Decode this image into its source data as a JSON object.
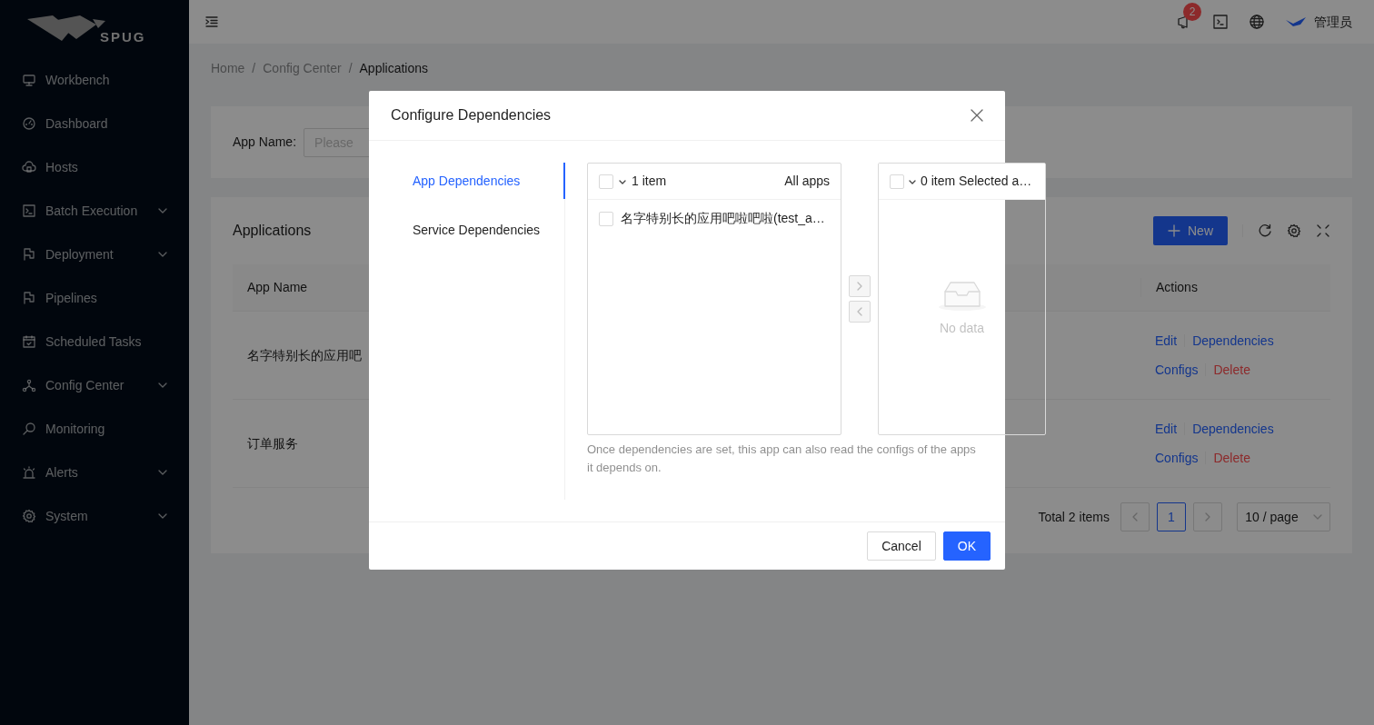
{
  "sidebar": {
    "logo_text": "SPUG",
    "items": [
      {
        "label": "Workbench",
        "expandable": false
      },
      {
        "label": "Dashboard",
        "expandable": false
      },
      {
        "label": "Hosts",
        "expandable": false
      },
      {
        "label": "Batch Execution",
        "expandable": true
      },
      {
        "label": "Deployment",
        "expandable": true
      },
      {
        "label": "Pipelines",
        "expandable": false
      },
      {
        "label": "Scheduled Tasks",
        "expandable": false
      },
      {
        "label": "Config Center",
        "expandable": true
      },
      {
        "label": "Monitoring",
        "expandable": false
      },
      {
        "label": "Alerts",
        "expandable": true
      },
      {
        "label": "System",
        "expandable": true
      }
    ]
  },
  "header": {
    "notification_count": "2",
    "user": "管理员"
  },
  "breadcrumb": {
    "items": [
      "Home",
      "Config Center",
      "Applications"
    ],
    "separators": [
      "/",
      "/"
    ]
  },
  "search": {
    "label": "App Name:",
    "placeholder": "Please"
  },
  "applications": {
    "title": "Applications",
    "new_button": "New",
    "columns": [
      "App Name",
      "Actions"
    ],
    "rows": [
      {
        "name": "名字特别长的应用吧",
        "actions": [
          {
            "label": "Edit",
            "kind": "link"
          },
          {
            "label": "Dependencies",
            "kind": "link"
          },
          {
            "label": "Configs",
            "kind": "link"
          },
          {
            "label": "Delete",
            "kind": "danger"
          }
        ]
      },
      {
        "name": "订单服务",
        "actions": [
          {
            "label": "Edit",
            "kind": "link"
          },
          {
            "label": "Dependencies",
            "kind": "link"
          },
          {
            "label": "Configs",
            "kind": "link"
          },
          {
            "label": "Delete",
            "kind": "danger"
          }
        ]
      }
    ],
    "total": "Total 2 items",
    "pages": [
      {
        "label": "1",
        "selected": true
      }
    ],
    "page_size": "10 / page"
  },
  "modal": {
    "title": "Configure Dependencies",
    "tabs": [
      {
        "label": "App Dependencies",
        "selected": true
      },
      {
        "label": "Service Dependencies",
        "selected": false
      }
    ],
    "source": {
      "count": "1 item",
      "title": "All apps",
      "checked": false,
      "items": [
        {
          "label": "名字特别长的应用吧啦吧啦(test_a…",
          "checked": false
        }
      ]
    },
    "target": {
      "count": "0 item Selected a…",
      "checked": false,
      "empty_text": "No data"
    },
    "help": "Once dependencies are set, this app can also read the configs of the apps it depends on.",
    "buttons": [
      {
        "label": "Cancel",
        "kind": "default"
      },
      {
        "label": "OK",
        "kind": "primary"
      }
    ]
  }
}
